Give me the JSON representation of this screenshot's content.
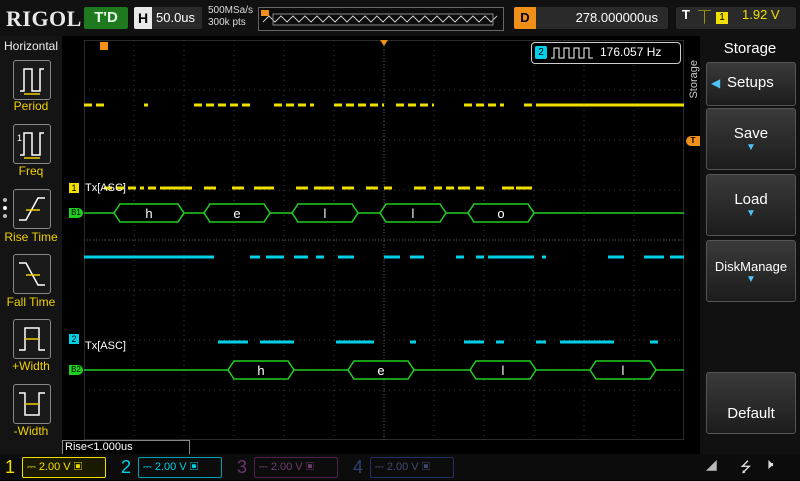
{
  "top": {
    "logo": "RIGOL",
    "trigger_state": "T'D",
    "horizontal_label": "H",
    "timebase": "50.0us",
    "sample_rate": "500MSa/s",
    "memory_depth": "300k pts",
    "delay_label": "D",
    "delay": "278.000000us",
    "trigger_label": "T",
    "trigger_source": "1",
    "trigger_level": "1.92 V"
  },
  "left_menu": {
    "title": "Horizontal",
    "items": [
      {
        "label": "Period"
      },
      {
        "label": "Freq"
      },
      {
        "label": "Rise Time"
      },
      {
        "label": "Fall Time"
      },
      {
        "label": "+Width"
      },
      {
        "label": "-Width"
      }
    ]
  },
  "right_menu": {
    "title": "Storage",
    "side_label": "Storage",
    "setups": "Setups",
    "save": "Save",
    "load": "Load",
    "disk_manage": "DiskManage",
    "default": "Default"
  },
  "measurement": {
    "freq_channel": "2",
    "freq_value": "176.057 Hz",
    "rise": "Rise<1.000us"
  },
  "decode": {
    "bus1_tag": "Tx[ASC]",
    "bus1_marker": "1",
    "bus1_id": "B1",
    "bus1_chars": [
      "h",
      "e",
      "l",
      "l",
      "o"
    ],
    "bus2_tag": "Tx[ASC]",
    "bus2_marker": "2",
    "bus2_id": "B2",
    "bus2_chars": [
      "h",
      "e",
      "l",
      "l"
    ]
  },
  "channels": [
    {
      "num": "1",
      "scale": "2.00 V",
      "color": "#f0e000",
      "active": true
    },
    {
      "num": "2",
      "scale": "2.00 V",
      "color": "#00d0e8",
      "active": true
    },
    {
      "num": "3",
      "scale": "2.00 V",
      "color": "#c040c0",
      "active": false
    },
    {
      "num": "4",
      "scale": "2.00 V",
      "color": "#3060d0",
      "active": false
    }
  ],
  "colors": {
    "ch1": "#f0e000",
    "ch2": "#00d0e8",
    "bus": "#20d020",
    "trigger": "#f09018"
  }
}
